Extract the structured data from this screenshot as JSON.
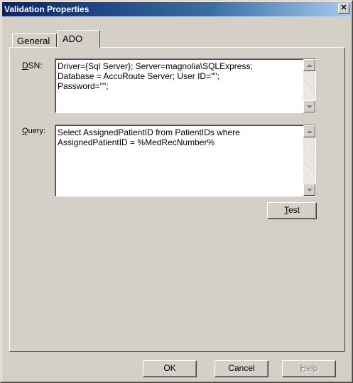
{
  "window": {
    "title": "Validation Properties",
    "close_glyph": "✕"
  },
  "tabs": [
    {
      "label": "General",
      "active": false
    },
    {
      "label": "ADO",
      "active": true
    }
  ],
  "dsn": {
    "label_mnemonic": "D",
    "label_rest": "SN:",
    "value": "Driver={Sql Server}; Server=magnolia\\SQLExpress;\nDatabase = AccuRoute Server; User ID=\"\";\nPassword=\"\";"
  },
  "query": {
    "label_mnemonic": "Q",
    "label_rest": "uery:",
    "value": "Select AssignedPatientID from PatientIDs where\nAssignedPatientID = %MedRecNumber%"
  },
  "test_button": {
    "mnemonic": "T",
    "rest": "est"
  },
  "footer": {
    "ok": "OK",
    "cancel": "Cancel",
    "help_mnemonic": "H",
    "help_rest": "elp"
  }
}
